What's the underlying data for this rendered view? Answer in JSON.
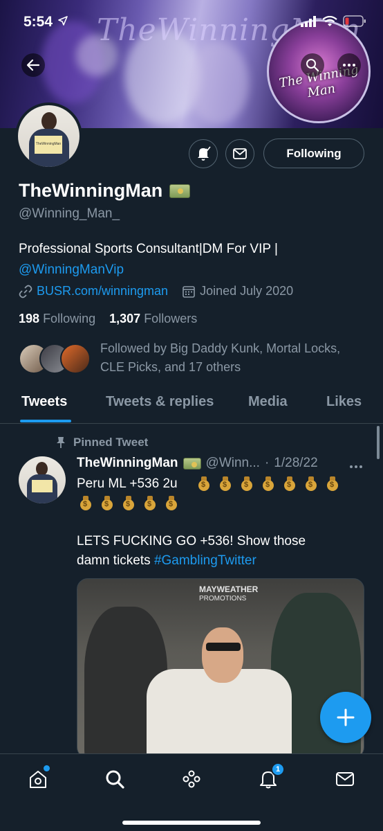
{
  "status_bar": {
    "time": "5:54"
  },
  "banner": {
    "script_text": "TheWinningMan",
    "badge_text": "The Winning Man"
  },
  "profile": {
    "name": "TheWinningMan",
    "handle": "@Winning_Man_",
    "bio_text": "Professional Sports Consultant|DM For VIP |",
    "bio_link": "@WinningManVip",
    "website": "BUSR.com/winningman",
    "joined": "Joined July 2020",
    "following_count": "198",
    "following_label": "Following",
    "followers_count": "1,307",
    "followers_label": "Followers",
    "followed_by_line1": "Followed by Big Daddy Kunk, Mortal Locks,",
    "followed_by_line2": "CLE Picks, and 17 others",
    "following_button": "Following",
    "avatar_sign_text": "TheWinningMan"
  },
  "tabs": [
    "Tweets",
    "Tweets & replies",
    "Media",
    "Likes"
  ],
  "tweet": {
    "pinned_label": "Pinned Tweet",
    "author_name": "TheWinningMan",
    "author_handle": "@Winn...",
    "separator": "·",
    "date": "1/28/22",
    "line1": "Peru ML +536 2u",
    "line2": "LETS FUCKING GO +536! Show those",
    "line3_prefix": "damn tickets ",
    "hashtag": "#GamblingTwitter",
    "media_logo_line1": "MAYWEATHER",
    "media_logo_line2": "PROMOTIONS"
  },
  "bottom_nav": {
    "notifications_badge": "1"
  },
  "colors": {
    "background": "#15202b",
    "accent": "#1d9bf0",
    "muted": "#8b98a5",
    "border": "#38444d"
  }
}
